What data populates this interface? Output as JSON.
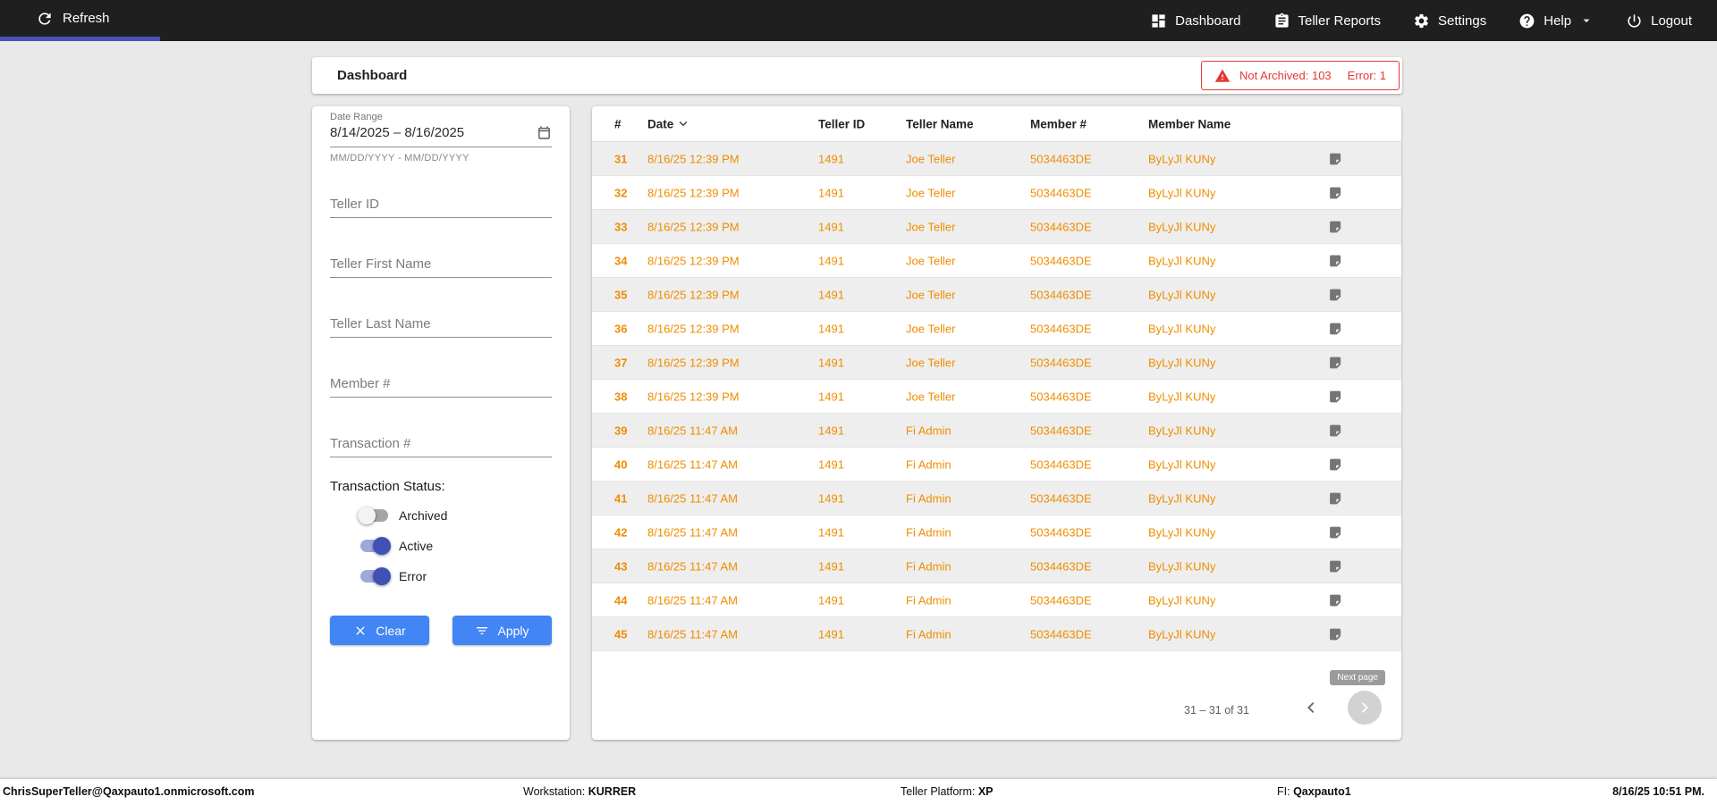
{
  "colors": {
    "topbar_bg": "#1F1F1F",
    "tab_indicator": "#4A51B5",
    "accent_orange": "#EF8D00",
    "primary_blue": "#4285F4",
    "toggle_on_thumb": "#3F51B5",
    "alert_red": "#E53935",
    "page_bg": "#E9E9E9"
  },
  "topbar": {
    "refresh_label": "Refresh",
    "nav": [
      {
        "label": "Dashboard",
        "icon": "dashboard-grid"
      },
      {
        "label": "Teller Reports",
        "icon": "clipboard"
      },
      {
        "label": "Settings",
        "icon": "gear"
      },
      {
        "label": "Help",
        "icon": "help-circle"
      },
      {
        "label": "Logout",
        "icon": "power"
      }
    ]
  },
  "header": {
    "title": "Dashboard",
    "alert": {
      "not_archived": "Not Archived: 103",
      "error": "Error: 1"
    }
  },
  "filters": {
    "date_range": {
      "label": "Date Range",
      "value": "8/14/2025 – 8/16/2025",
      "helper": "MM/DD/YYYY - MM/DD/YYYY"
    },
    "fields": [
      {
        "placeholder": "Teller ID"
      },
      {
        "placeholder": "Teller First Name"
      },
      {
        "placeholder": "Teller Last Name"
      },
      {
        "placeholder": "Member #"
      },
      {
        "placeholder": "Transaction #"
      }
    ],
    "status_label": "Transaction Status:",
    "toggles": [
      {
        "label": "Archived",
        "on": false
      },
      {
        "label": "Active",
        "on": true
      },
      {
        "label": "Error",
        "on": true
      }
    ],
    "clear_label": "Clear",
    "apply_label": "Apply"
  },
  "table": {
    "columns": [
      "#",
      "Date",
      "Teller ID",
      "Teller Name",
      "Member #",
      "Member Name"
    ],
    "rows": [
      {
        "num": "31",
        "date": "8/16/25 12:39 PM",
        "teller_id": "1491",
        "teller_name": "Joe Teller",
        "member_num": "5034463DE",
        "member_name": "ByLyJl KUNy"
      },
      {
        "num": "32",
        "date": "8/16/25 12:39 PM",
        "teller_id": "1491",
        "teller_name": "Joe Teller",
        "member_num": "5034463DE",
        "member_name": "ByLyJl KUNy"
      },
      {
        "num": "33",
        "date": "8/16/25 12:39 PM",
        "teller_id": "1491",
        "teller_name": "Joe Teller",
        "member_num": "5034463DE",
        "member_name": "ByLyJl KUNy"
      },
      {
        "num": "34",
        "date": "8/16/25 12:39 PM",
        "teller_id": "1491",
        "teller_name": "Joe Teller",
        "member_num": "5034463DE",
        "member_name": "ByLyJl KUNy"
      },
      {
        "num": "35",
        "date": "8/16/25 12:39 PM",
        "teller_id": "1491",
        "teller_name": "Joe Teller",
        "member_num": "5034463DE",
        "member_name": "ByLyJl KUNy"
      },
      {
        "num": "36",
        "date": "8/16/25 12:39 PM",
        "teller_id": "1491",
        "teller_name": "Joe Teller",
        "member_num": "5034463DE",
        "member_name": "ByLyJl KUNy"
      },
      {
        "num": "37",
        "date": "8/16/25 12:39 PM",
        "teller_id": "1491",
        "teller_name": "Joe Teller",
        "member_num": "5034463DE",
        "member_name": "ByLyJl KUNy"
      },
      {
        "num": "38",
        "date": "8/16/25 12:39 PM",
        "teller_id": "1491",
        "teller_name": "Joe Teller",
        "member_num": "5034463DE",
        "member_name": "ByLyJl KUNy"
      },
      {
        "num": "39",
        "date": "8/16/25 11:47 AM",
        "teller_id": "1491",
        "teller_name": "Fi Admin",
        "member_num": "5034463DE",
        "member_name": "ByLyJl KUNy"
      },
      {
        "num": "40",
        "date": "8/16/25 11:47 AM",
        "teller_id": "1491",
        "teller_name": "Fi Admin",
        "member_num": "5034463DE",
        "member_name": "ByLyJl KUNy"
      },
      {
        "num": "41",
        "date": "8/16/25 11:47 AM",
        "teller_id": "1491",
        "teller_name": "Fi Admin",
        "member_num": "5034463DE",
        "member_name": "ByLyJl KUNy"
      },
      {
        "num": "42",
        "date": "8/16/25 11:47 AM",
        "teller_id": "1491",
        "teller_name": "Fi Admin",
        "member_num": "5034463DE",
        "member_name": "ByLyJl KUNy"
      },
      {
        "num": "43",
        "date": "8/16/25 11:47 AM",
        "teller_id": "1491",
        "teller_name": "Fi Admin",
        "member_num": "5034463DE",
        "member_name": "ByLyJl KUNy"
      },
      {
        "num": "44",
        "date": "8/16/25 11:47 AM",
        "teller_id": "1491",
        "teller_name": "Fi Admin",
        "member_num": "5034463DE",
        "member_name": "ByLyJl KUNy"
      },
      {
        "num": "45",
        "date": "8/16/25 11:47 AM",
        "teller_id": "1491",
        "teller_name": "Fi Admin",
        "member_num": "5034463DE",
        "member_name": "ByLyJl KUNy"
      }
    ],
    "pagination": {
      "range_text": "31 – 31 of 31",
      "next_tooltip": "Next page"
    }
  },
  "footer": {
    "user": "ChrisSuperTeller@Qaxpauto1.onmicrosoft.com",
    "workstation_label": "Workstation:",
    "workstation_value": "KURRER",
    "platform_label": "Teller Platform:",
    "platform_value": "XP",
    "fi_label": "FI:",
    "fi_value": "Qaxpauto1",
    "datetime": "8/16/25 10:51 PM."
  }
}
